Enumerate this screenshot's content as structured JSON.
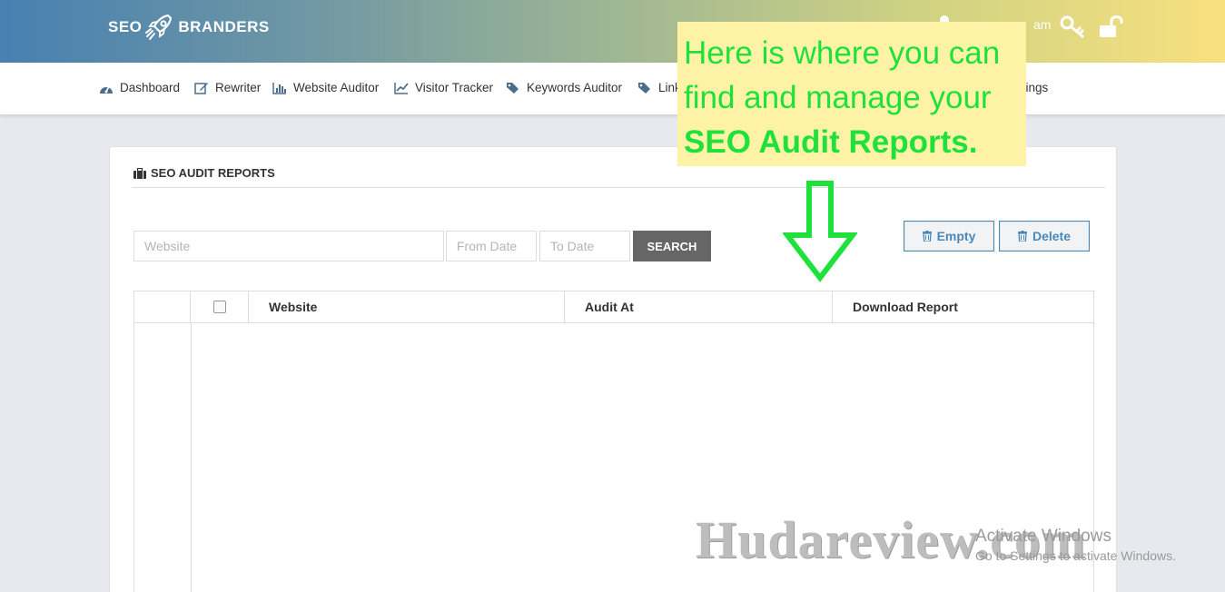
{
  "header": {
    "logo_left": "SEO",
    "logo_right": "BRANDERS",
    "logo_icon": "rocket-icon",
    "username_visible": "am",
    "icons": [
      "user-icon",
      "key-icon",
      "unlock-icon"
    ]
  },
  "nav": {
    "items": [
      {
        "label": "Dashboard",
        "icon": "dashboard-icon"
      },
      {
        "label": "Rewriter",
        "icon": "edit-icon"
      },
      {
        "label": "Website Auditor",
        "icon": "bar-chart-icon"
      },
      {
        "label": "Visitor Tracker",
        "icon": "line-chart-icon"
      },
      {
        "label": "Keywords Auditor",
        "icon": "tags-icon"
      },
      {
        "label": "Link",
        "icon": "tags-icon"
      },
      {
        "label": "ttings",
        "icon": ""
      }
    ]
  },
  "card": {
    "title": "SEO AUDIT REPORTS",
    "title_icon": "briefcase-icon",
    "filters": {
      "website_placeholder": "Website",
      "from_placeholder": "From Date",
      "to_placeholder": "To Date",
      "search_label": "SEARCH"
    },
    "actions": {
      "empty_label": "Empty",
      "delete_label": "Delete"
    },
    "table": {
      "columns": [
        "Website",
        "Audit At",
        "Download Report"
      ],
      "rows": []
    }
  },
  "callout": {
    "line1": "Here is where you can",
    "line2": "find and manage your",
    "highlight": "SEO Audit Reports."
  },
  "watermark": "Hudareview.com",
  "os_overlay": {
    "title": "Activate Windows",
    "subtitle": "Go to Settings to activate Windows."
  },
  "colors": {
    "accent_blue": "#4b88ba",
    "callout_bg": "#fdf2a5",
    "callout_text": "#1ee13b",
    "search_btn": "#666666"
  }
}
